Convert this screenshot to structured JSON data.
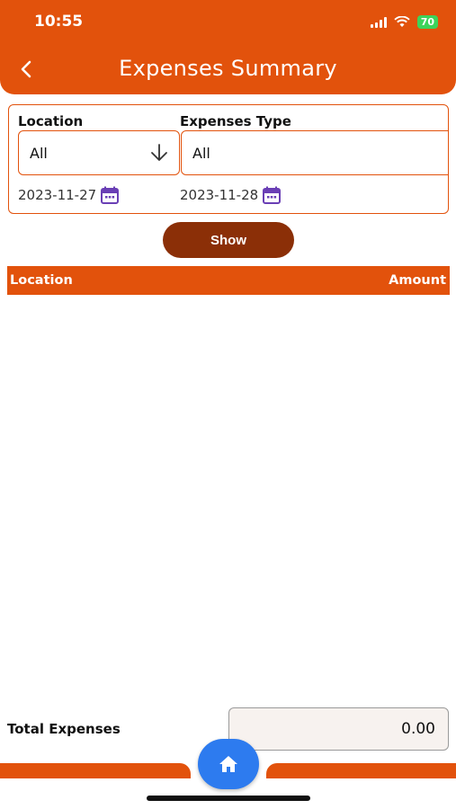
{
  "status_bar": {
    "time": "10:55",
    "battery": "70"
  },
  "header": {
    "title": "Expenses Summary"
  },
  "filters": {
    "location_label": "Location",
    "location_value": "All",
    "type_label": "Expenses Type",
    "type_value": "All",
    "date_from": "2023-11-27",
    "date_to": "2023-11-28"
  },
  "show_button": "Show",
  "table": {
    "columns": [
      "Location",
      "Amount"
    ],
    "rows": []
  },
  "total": {
    "label": "Total Expenses",
    "value": "0.00"
  },
  "colors": {
    "primary": "#E2520C",
    "button": "#8B2F07",
    "home_fab": "#2D7BEF",
    "calendar_icon": "#6A3FB5"
  },
  "icons": [
    "back-arrow-icon",
    "chevron-down-icon",
    "calendar-icon",
    "home-icon",
    "wifi-icon",
    "signal-icon",
    "battery-icon"
  ]
}
